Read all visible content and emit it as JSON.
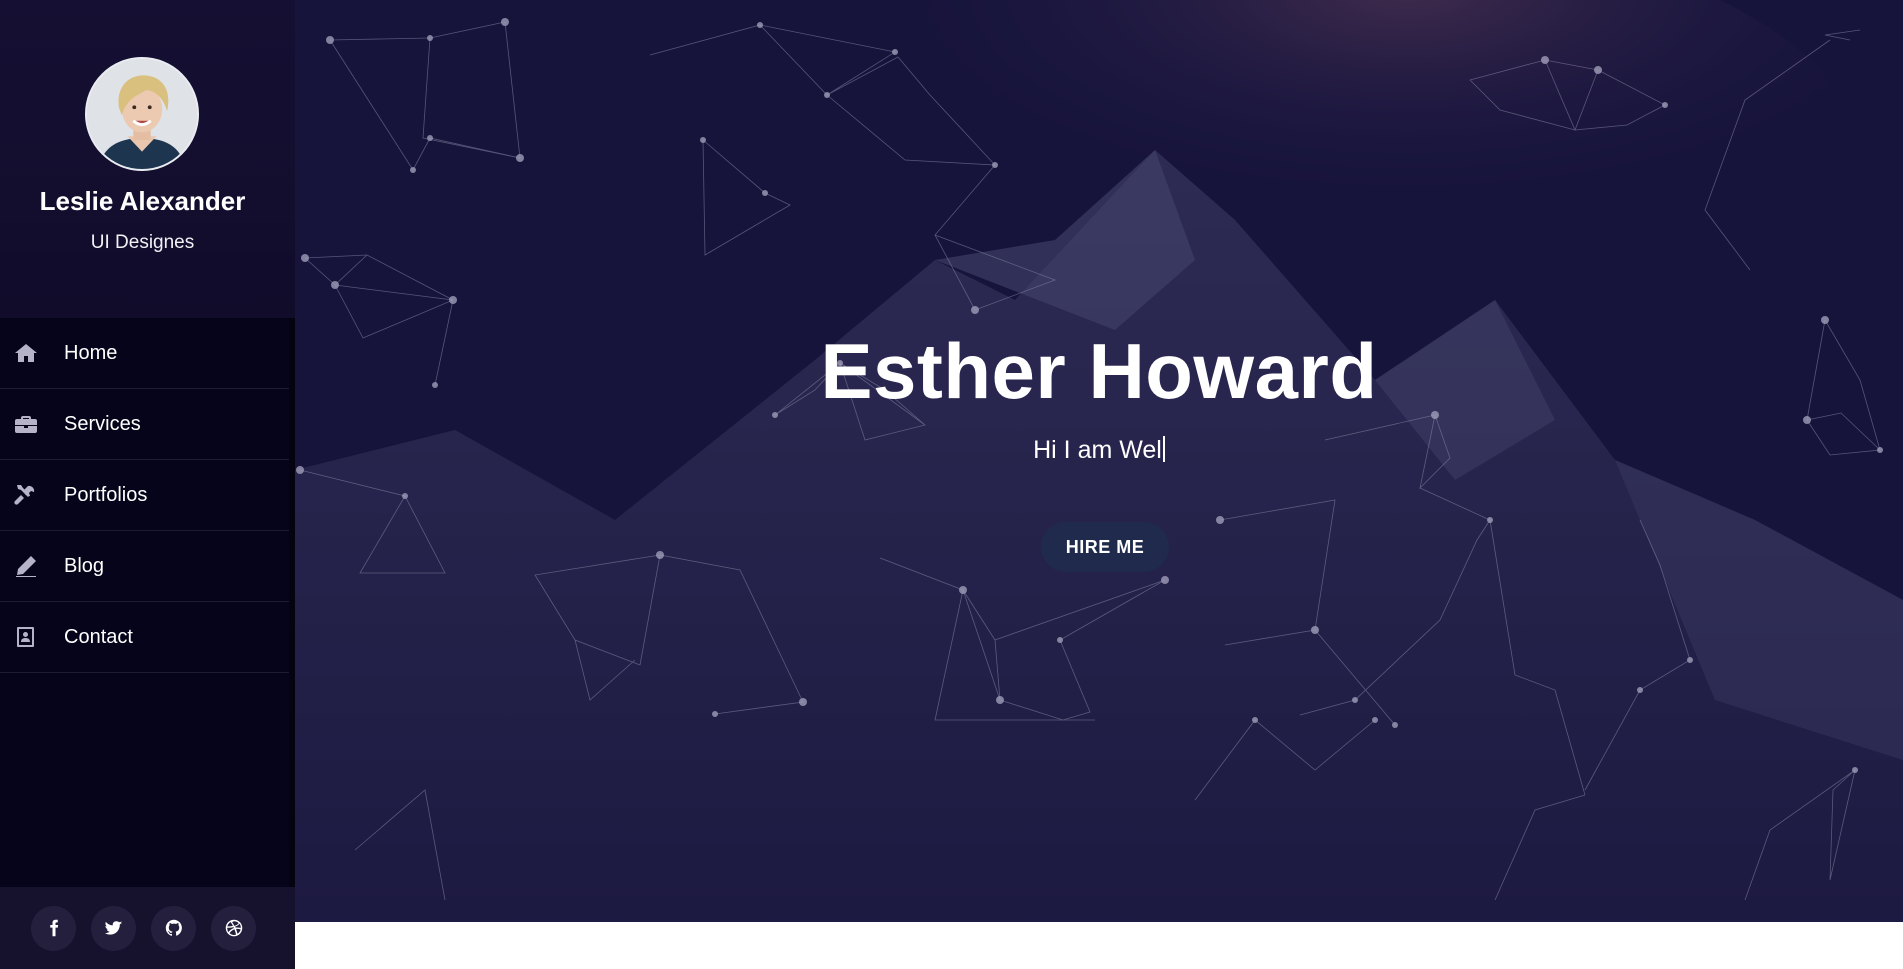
{
  "profile": {
    "name": "Leslie Alexander",
    "role": "UI Designes"
  },
  "nav": {
    "items": [
      {
        "label": "Home",
        "icon": "home-icon"
      },
      {
        "label": "Services",
        "icon": "briefcase-icon"
      },
      {
        "label": "Portfolios",
        "icon": "tools-icon"
      },
      {
        "label": "Blog",
        "icon": "pencil-icon"
      },
      {
        "label": "Contact",
        "icon": "contact-card-icon"
      }
    ]
  },
  "social": {
    "items": [
      "facebook-icon",
      "twitter-icon",
      "github-icon",
      "dribbble-icon"
    ]
  },
  "hero": {
    "title": "Esther Howard",
    "subtitle": "Hi I am Wel",
    "button_label": "HIRE ME"
  },
  "colors": {
    "sidebar_bg": "#06041a",
    "profile_bg": "#150f33",
    "hero_overlay": "#1d1944",
    "button_bg": "#1f2a4c",
    "accent_text": "#ffffff"
  }
}
